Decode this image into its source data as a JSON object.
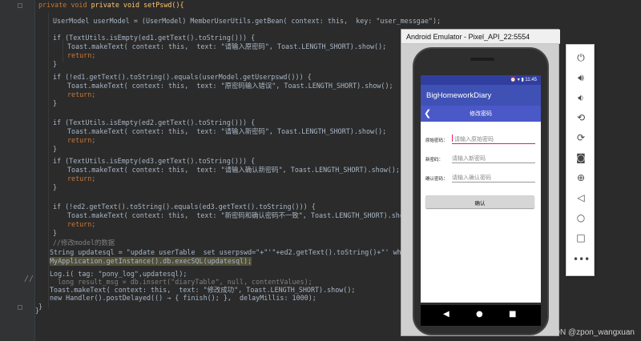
{
  "code": {
    "lines": [
      {
        "t": "private void setPswd(){"
      },
      {
        "t": "UserModel userModel = (UserModel) MemberUserUtils.getBean( context: this,  key: \"user_messgae\");"
      },
      {
        "t": "if (TextUtils.isEmpty(ed1.getText().toString())) {"
      },
      {
        "t": "Toast.makeText( context: this,  text: \"请输入原密码\", Toast.LENGTH_SHORT).show();"
      },
      {
        "t": "return;"
      },
      {
        "t": "}"
      },
      {
        "t": "if (!ed1.getText().toString().equals(userModel.getUserpswd())) {"
      },
      {
        "t": "Toast.makeText( context: this,  text: \"原密码输入错误\", Toast.LENGTH_SHORT).show();"
      },
      {
        "t": "return;"
      },
      {
        "t": "}"
      },
      {
        "t": "if (TextUtils.isEmpty(ed2.getText().toString())) {"
      },
      {
        "t": "Toast.makeText( context: this,  text: \"请输入新密码\", Toast.LENGTH_SHORT).show();"
      },
      {
        "t": "return;"
      },
      {
        "t": "}"
      },
      {
        "t": "if (TextUtils.isEmpty(ed3.getText().toString())) {"
      },
      {
        "t": "Toast.makeText( context: this,  text: \"请输入确认新密码\", Toast.LENGTH_SHORT).show();"
      },
      {
        "t": "return;"
      },
      {
        "t": "}"
      },
      {
        "t": "if (!ed2.getText().toString().equals(ed3.getText().toString())) {"
      },
      {
        "t": "Toast.makeText( context: this,  text: \"新密码和确认密码不一致\", Toast.LENGTH_SHORT).show();"
      },
      {
        "t": "return;"
      },
      {
        "t": "}"
      },
      {
        "t": "//修改model的数据"
      },
      {
        "t": "String updatesql = \"update userTable  set userpswd=\"+\"'\"+ed2.getText().toString()+\"' where _id ="
      },
      {
        "t": "MyApplication.getInstance().db.execSQL(updatesql);"
      },
      {
        "t": "Log.i( tag: \"pony_log\",updatesql);"
      },
      {
        "t": "long result_msg = db.insert(\"diaryTable\", null, contentValues);"
      },
      {
        "t": "Toast.makeText( context: this,  text: \"修改成功\", Toast.LENGTH_SHORT).show();"
      },
      {
        "t": "new Handler().postDelayed(() → { finish(); },  delayMillis: 1000);"
      },
      {
        "t": "}"
      },
      {
        "t": "}"
      }
    ]
  },
  "emulator": {
    "window_title": "Android Emulator - Pixel_API_22:5554",
    "status_time": "11:45",
    "app_title": "BigHomeworkDiary",
    "page_title": "修改密码",
    "back_icon": "back-arrow-icon",
    "fields": [
      {
        "label": "原始密码：",
        "placeholder": "请输入原始密码"
      },
      {
        "label": "新密码：",
        "placeholder": "请输入新密码"
      },
      {
        "label": "确认密码：",
        "placeholder": "请输入确认密码"
      }
    ],
    "confirm_label": "确认",
    "nav": {
      "back": "◀",
      "home": "●",
      "recents": "■"
    }
  },
  "tools": [
    "power-icon",
    "volume-up-icon",
    "volume-down-icon",
    "rotate-left-icon",
    "rotate-right-icon",
    "camera-icon",
    "zoom-icon",
    "back-icon",
    "home-icon",
    "overview-icon",
    "more-icon"
  ],
  "watermark": "CSDN @zpon_wangxuan"
}
